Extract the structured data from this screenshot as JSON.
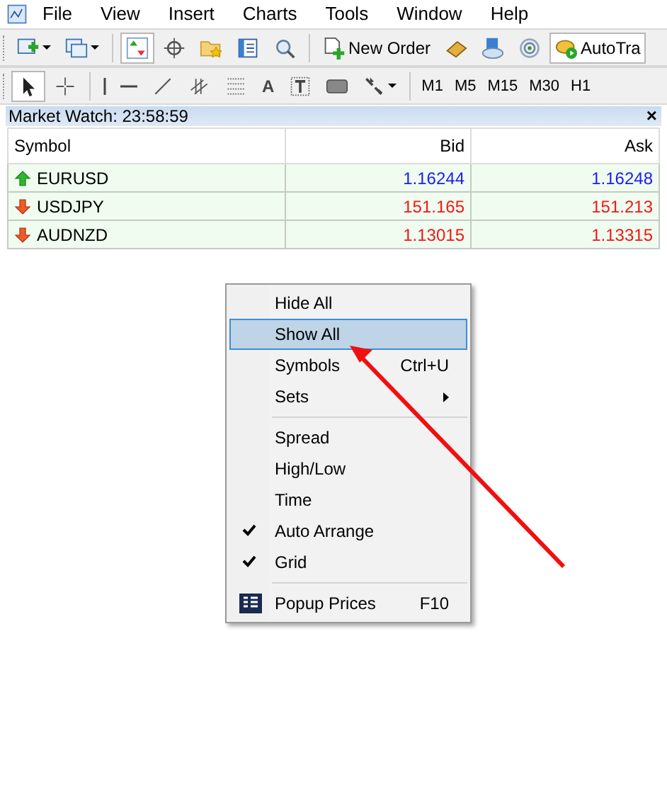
{
  "menu_bar": [
    "File",
    "View",
    "Insert",
    "Charts",
    "Tools",
    "Window",
    "Help"
  ],
  "toolbar": {
    "new_order": "New Order",
    "auto_trading": "AutoTra",
    "market_watch_pressed": true
  },
  "drawing_toolbar": {
    "cursor_pressed": true,
    "text_tool": "A",
    "timeframes": [
      "M1",
      "M5",
      "M15",
      "M30",
      "H1"
    ]
  },
  "market_watch": {
    "title": "Market Watch: 23:58:59",
    "close": "×",
    "columns": [
      "Symbol",
      "Bid",
      "Ask"
    ],
    "rows": [
      {
        "symbol": "EURUSD",
        "kind": "up",
        "bid": "1.16244",
        "ask": "1.16248"
      },
      {
        "symbol": "USDJPY",
        "kind": "down",
        "bid": "151.165",
        "ask": "151.213"
      },
      {
        "symbol": "AUDNZD",
        "kind": "down",
        "bid": "1.13015",
        "ask": "1.13315"
      }
    ]
  },
  "context_menu": [
    {
      "kind": "item",
      "label": "Hide All",
      "checked": false,
      "selected": false
    },
    {
      "kind": "item",
      "label": "Show All",
      "checked": false,
      "selected": true
    },
    {
      "kind": "item",
      "label": "Symbols",
      "shortcut": "Ctrl+U",
      "checked": false,
      "selected": false
    },
    {
      "kind": "submenu",
      "label": "Sets",
      "checked": false,
      "selected": false
    },
    {
      "kind": "separator"
    },
    {
      "kind": "item",
      "label": "Spread",
      "checked": false,
      "selected": false
    },
    {
      "kind": "item",
      "label": "High/Low",
      "checked": false,
      "selected": false
    },
    {
      "kind": "item",
      "label": "Time",
      "checked": false,
      "selected": false
    },
    {
      "kind": "item",
      "label": "Auto Arrange",
      "checked": true,
      "selected": false
    },
    {
      "kind": "item",
      "label": "Grid",
      "checked": true,
      "selected": false
    },
    {
      "kind": "separator"
    },
    {
      "kind": "icon-item",
      "label": "Popup Prices",
      "shortcut": "F10",
      "checked": false,
      "selected": false
    }
  ]
}
